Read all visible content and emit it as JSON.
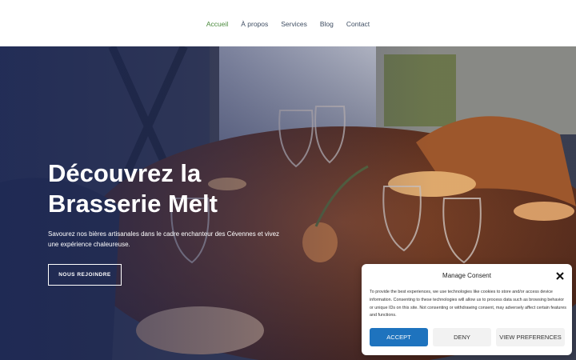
{
  "nav": {
    "items": [
      {
        "label": "Accueil",
        "active": true
      },
      {
        "label": "À propos",
        "active": false
      },
      {
        "label": "Services",
        "active": false
      },
      {
        "label": "Blog",
        "active": false
      },
      {
        "label": "Contact",
        "active": false
      }
    ]
  },
  "hero": {
    "title": "Découvrez la Brasserie Melt",
    "subtitle": "Savourez nos bières artisanales dans le cadre enchanteur des Cévennes et vivez une expérience chaleureuse.",
    "cta_label": "NOUS REJOINDRE"
  },
  "consent": {
    "title": "Manage Consent",
    "text": "To provide the best experiences, we use technologies like cookies to store and/or access device information. Consenting to these technologies will allow us to process data such as browsing behavior or unique IDs on this site. Not consenting or withdrawing consent, may adversely affect certain features and functions.",
    "accept_label": "ACCEPT",
    "deny_label": "DENY",
    "preferences_label": "VIEW PREFERENCES"
  },
  "colors": {
    "nav_active": "#4a8a3c",
    "nav_text": "#3f4e63",
    "accept_button": "#1e73be",
    "hero_overlay": "#1c2858"
  },
  "icons": [
    "close-icon"
  ]
}
